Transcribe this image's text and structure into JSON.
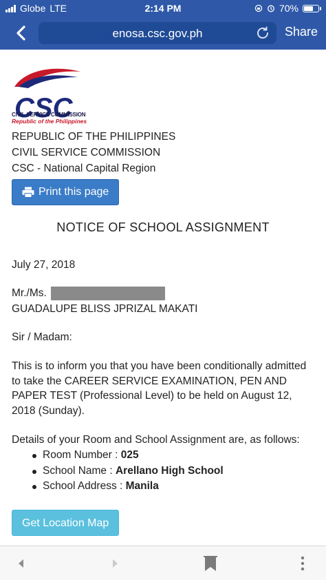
{
  "status_bar": {
    "carrier": "Globe",
    "network": "LTE",
    "time": "2:14 PM",
    "battery": "70%",
    "battery_level": 0.7
  },
  "browser": {
    "url": "enosa.csc.gov.ph",
    "share_label": "Share",
    "accent": "#2f59a8"
  },
  "logo": {
    "text": "CSC",
    "subtitle": "CIVIL SERVICE COMMISSION",
    "tagline": "Republic of the Philippines"
  },
  "header": {
    "line1": "REPUBLIC OF THE PHILIPPINES",
    "line2": "CIVIL SERVICE COMMISSION",
    "line3": "CSC - National Capital Region"
  },
  "print_button": {
    "label": "Print this page",
    "icon": "printer-icon"
  },
  "notice": {
    "title": "NOTICE OF SCHOOL ASSIGNMENT",
    "date": "July 27, 2018",
    "salutation": "Mr./Ms.",
    "addressee": "GUADALUPE BLISS JPRIZAL MAKATI",
    "greeting": "Sir / Madam:",
    "body": "This is to inform you that you have been conditionally admitted to take the CAREER SERVICE EXAMINATION, PEN AND PAPER TEST (Professional Level)  to be held on August 12, 2018 (Sunday).",
    "details_intro": "Details of your Room and School Assignment are, as follows:",
    "details": [
      {
        "label": "Room Number : ",
        "value": "025"
      },
      {
        "label": "School Name : ",
        "value": "Arellano High School"
      },
      {
        "label": "School Address : ",
        "value": "Manila"
      }
    ]
  },
  "map_button": {
    "label": "Get Location Map"
  },
  "toolbar": {
    "icons": [
      "back-arrow-icon",
      "forward-arrow-icon",
      "bookmarks-icon",
      "more-icon"
    ]
  }
}
